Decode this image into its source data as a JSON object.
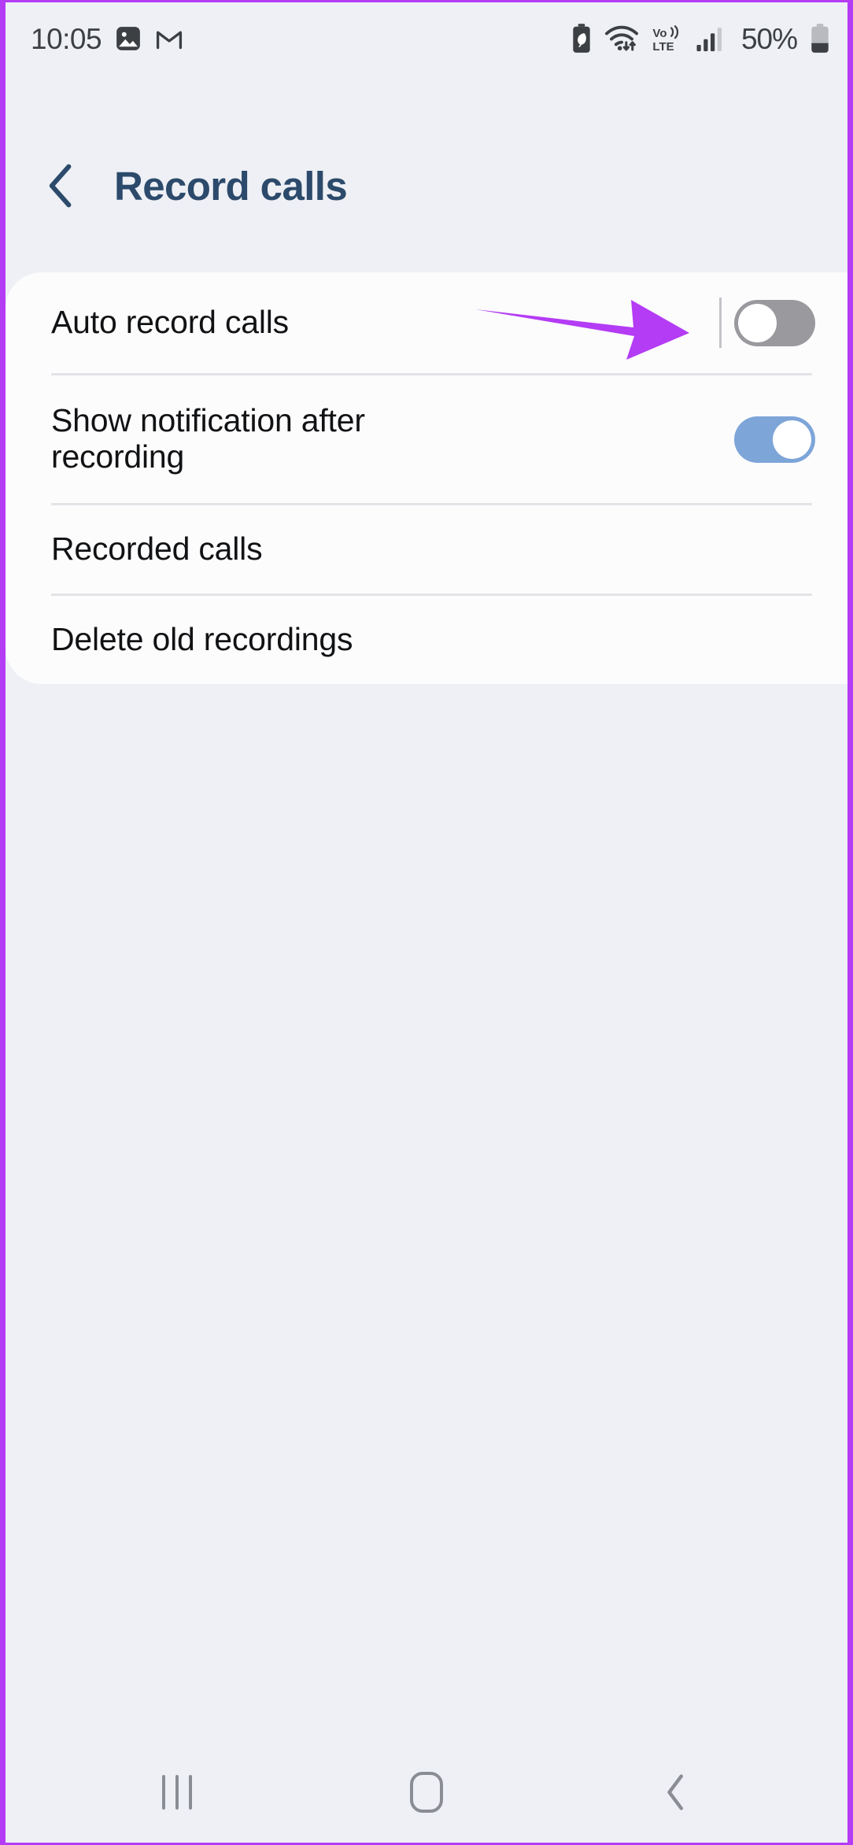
{
  "status_bar": {
    "clock": "10:05",
    "battery_percent": "50%",
    "left_icons": [
      "photos-icon",
      "gmail-icon"
    ],
    "right_icons": [
      "battery-saver-icon",
      "wifi-icon",
      "volte-icon",
      "signal-bars-icon",
      "battery-icon"
    ],
    "volte_label_top": "Vo))",
    "volte_label_bottom": "LTE"
  },
  "header": {
    "back_icon": "chevron-left-icon",
    "title": "Record calls",
    "title_color": "#2c4a6b"
  },
  "settings": {
    "rows": [
      {
        "label": "Auto record calls",
        "control": "toggle",
        "state": "off"
      },
      {
        "label": "Show notification after recording",
        "control": "toggle",
        "state": "on"
      },
      {
        "label": "Recorded calls",
        "control": "none",
        "state": ""
      },
      {
        "label": "Delete old recordings",
        "control": "none",
        "state": ""
      }
    ]
  },
  "annotation": {
    "type": "arrow",
    "color": "#b43cf5",
    "points_to": "Auto record calls toggle",
    "direction": "right"
  },
  "nav_bar": {
    "recents_icon": "recents-icon",
    "home_icon": "home-icon",
    "back_icon": "nav-back-icon"
  },
  "colors": {
    "page_background": "#eef0f5",
    "card_background": "#fcfcfd",
    "toggle_on": "#7da5d8",
    "toggle_off": "#9a9a9e",
    "accent_purple": "#b43cf5",
    "divider": "#e3e4e8",
    "text_primary": "#111214",
    "status_text": "#3d4043"
  }
}
